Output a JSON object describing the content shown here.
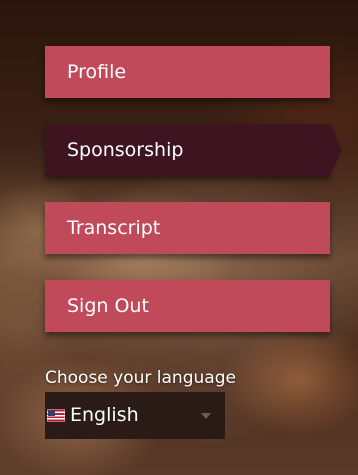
{
  "menu": {
    "items": [
      {
        "label": "Profile",
        "active": false
      },
      {
        "label": "Sponsorship",
        "active": true
      },
      {
        "label": "Transcript",
        "active": false
      },
      {
        "label": "Sign Out",
        "active": false
      }
    ]
  },
  "language": {
    "label": "Choose your language",
    "selected": "English",
    "flag_icon": "us-flag-icon"
  },
  "colors": {
    "button": "#c04a5a",
    "active_button": "#3e1420",
    "select_bg": "#2a1b16"
  }
}
